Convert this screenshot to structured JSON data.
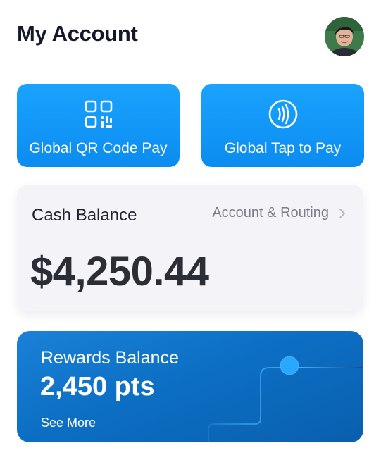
{
  "header": {
    "title": "My Account",
    "avatar_icon": "user-avatar"
  },
  "quick_pay": [
    {
      "label": "Global QR Code Pay",
      "icon": "qr-code-icon"
    },
    {
      "label": "Global Tap to Pay",
      "icon": "contactless-icon"
    }
  ],
  "cash": {
    "title": "Cash Balance",
    "link_label": "Account & Routing",
    "amount": "$4,250.44"
  },
  "rewards": {
    "title": "Rewards Balance",
    "points": "2,450 pts",
    "see_more": "See More"
  },
  "colors": {
    "pay_card": "#0b8cf0",
    "rewards_card": "#0c6fc4",
    "cash_card_bg": "#f4f4f8"
  }
}
